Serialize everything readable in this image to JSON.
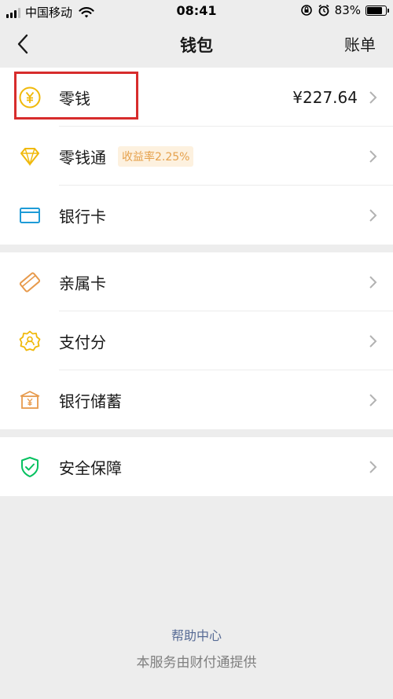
{
  "status_bar": {
    "carrier": "中国移动",
    "time": "08:41",
    "battery": "83%",
    "battery_level": 0.83
  },
  "nav": {
    "title": "钱包",
    "right_label": "账单"
  },
  "group1": [
    {
      "label": "零钱",
      "value": "¥227.64",
      "icon": "yuan-coin-icon"
    },
    {
      "label": "零钱通",
      "badge": "收益率2.25%",
      "icon": "diamond-icon"
    },
    {
      "label": "银行卡",
      "icon": "bank-card-icon"
    }
  ],
  "group2": [
    {
      "label": "亲属卡",
      "icon": "family-card-icon"
    },
    {
      "label": "支付分",
      "icon": "pay-score-icon"
    },
    {
      "label": "银行储蓄",
      "icon": "bank-savings-icon"
    }
  ],
  "group3": [
    {
      "label": "安全保障",
      "icon": "security-shield-icon"
    }
  ],
  "footer": {
    "help_link": "帮助中心",
    "provider_text": "本服务由财付通提供"
  },
  "colors": {
    "background": "#ededed",
    "gold": "#f0b90b",
    "blue": "#1e9bd7",
    "orange": "#e79a4c",
    "green": "#07c160",
    "link": "#576b95",
    "highlight": "#d72c2c"
  }
}
